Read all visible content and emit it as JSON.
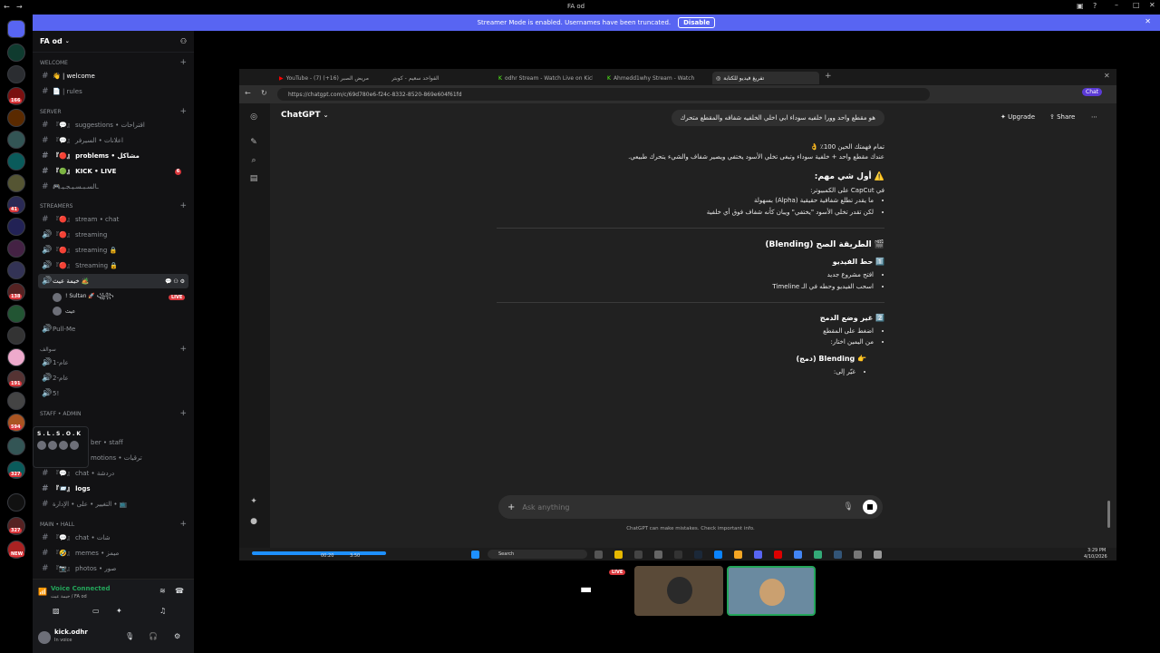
{
  "window": {
    "title": "FA od"
  },
  "banner": {
    "text": "Streamer Mode is enabled. Usernames have been truncated.",
    "button": "Disable"
  },
  "rail": {
    "badges": [
      "166",
      "41",
      "138",
      "191",
      "594",
      "327",
      "327",
      "NEW"
    ]
  },
  "server": {
    "name": "FA od"
  },
  "categories": {
    "welcome": "welcome",
    "server": "SERVER",
    "streamers": "STREAMERS",
    "swalef": "سوالف",
    "staff": "STAFF • ADMIN",
    "main": "MAIN • HALL"
  },
  "channels": {
    "welcome": "👋 | welcome",
    "rules": "📄 | rules",
    "suggestions": "『💬』 suggestions • اقتراحات",
    "ads": "『💬』 اعلانات • السيرفر",
    "problems": "『🔴』 problems • مشاكل",
    "kicklive": "『🟢』 KICK • LIVE",
    "games": "🎮ـالسـبـسـيـجـيـ",
    "stream_chat": "『🔴』 stream • chat",
    "streaming1": "『🔴』 streaming",
    "streaming2": "『🔴』 streaming 🔒",
    "streaming3": "『🔴』 Streaming 🔒",
    "voice_active": "خيمة عيث 🏕️",
    "pullme": "Pull-Me",
    "v1": "عام-1",
    "v2": "عام-2",
    "v3": "5!",
    "staff": "ber • staff",
    "promotions": "motions • ترقيات",
    "chat_staff": "『💬』 chat • دردشة",
    "logs": "『📨』 logs",
    "admin_change": "التغيير • على • الإدارة • 📺",
    "chat_main": "『💬』 chat • شات",
    "memes": "『🤣』 memes • ميمز",
    "photos": "『📷』 photos • صور"
  },
  "voice_users": [
    {
      "name": "! Sultan 🚀 ꧁꧂",
      "live": "LIVE"
    },
    {
      "name": "عيث",
      "live": ""
    }
  ],
  "badge_counts": {
    "kicklive": "6"
  },
  "tooltip": {
    "title": "S . L . S . O . K"
  },
  "voice_connected": {
    "status": "Voice Connected",
    "channel": "خيمة عيث / FA od"
  },
  "user_panel": {
    "name": "kick.odhr",
    "status": "In voice"
  },
  "browser": {
    "tabs": [
      "YouTube - (7) مريض الصبر (16+)",
      "الفواحد سعيم - كوبتر",
      "odhr Stream - Watch Live on Kick",
      "Ahmedd1why Stream - Watch",
      "تفريغ فيديو للكتابة"
    ],
    "url": "https://chatgpt.com/c/69d780e6-f24c-8332-8520-869e604f61fd"
  },
  "chatgpt": {
    "title": "ChatGPT",
    "upgrade": "Upgrade",
    "share": "Share",
    "user_message": "هو مقطع واحد وورا خلفيه سوداء ابي اخلي الخلفيه شفافه والمقطع متحرك",
    "p1": "تمام فهمتك الحين 100٪ 👌",
    "p2": "عندك مقطع واحد + خلفية سوداء وتبغى تخلي الأسود يختفي ويصير شفاف والشيء يتحرك طبيعي.",
    "h1": "⚠️ أول شي مهم:",
    "p3": "في CapCut على الكمبيوتر:",
    "list1": [
      "ما يقدر تطلع شفافية حقيقية (Alpha) بسهولة",
      "لكن تقدر تخلي الأسود \"يختفي\" ويبان كأنه شفاف فوق أي خلفية"
    ],
    "h2": "🎬 الطريقة الصح (Blending)",
    "h3": "1️⃣ حط الفيديو",
    "list2": [
      "افتح مشروع جديد",
      "اسحب الفيديو وحطه في الـ Timeline"
    ],
    "h4": "2️⃣ غير وضع الدمج",
    "list3": [
      "اضغط على المقطع",
      "من اليمين اختار:"
    ],
    "h5": "👉 Blending (دمج)",
    "list4": [
      "غيّر إلى:"
    ],
    "placeholder": "Ask anything",
    "disclaimer": "ChatGPT can make mistakes. Check important info."
  },
  "taskbar": {
    "search": "Search",
    "time": "3:29 PM",
    "date": "4/10/2026",
    "media_times": [
      "00:20",
      "3:50"
    ]
  },
  "tiles": {
    "live": "LIVE"
  }
}
